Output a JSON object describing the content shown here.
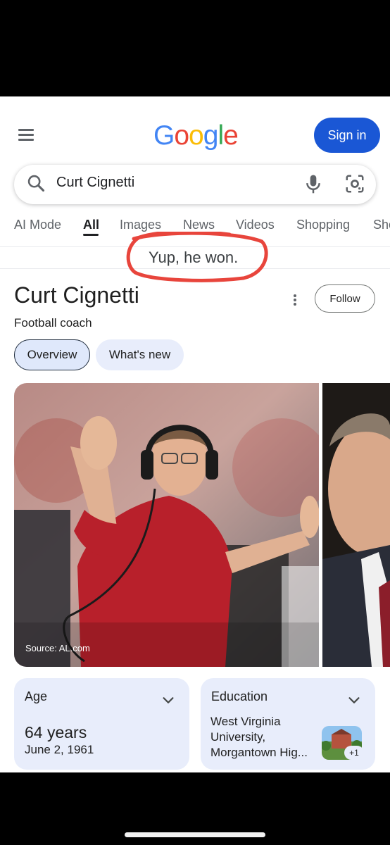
{
  "header": {
    "logo_letters": [
      {
        "ch": "G",
        "color": "#4285F4"
      },
      {
        "ch": "o",
        "color": "#EA4335"
      },
      {
        "ch": "o",
        "color": "#FBBC05"
      },
      {
        "ch": "g",
        "color": "#4285F4"
      },
      {
        "ch": "l",
        "color": "#34A853"
      },
      {
        "ch": "e",
        "color": "#EA4335"
      }
    ],
    "signin_label": "Sign in",
    "signin_color": "#1A57D5"
  },
  "search": {
    "query": "Curt Cignetti"
  },
  "tabs": [
    {
      "label": "AI Mode"
    },
    {
      "label": "All",
      "active": true
    },
    {
      "label": "Images"
    },
    {
      "label": "News"
    },
    {
      "label": "Videos"
    },
    {
      "label": "Shopping"
    },
    {
      "label": "Sho"
    }
  ],
  "annotation": {
    "text": "Yup, he won.",
    "circle_color": "#E8453C"
  },
  "knowledge_panel": {
    "title": "Curt Cignetti",
    "subtitle": "Football coach",
    "follow_label": "Follow",
    "chips": [
      "Overview",
      "What's new"
    ],
    "photo_source": "Source: AL.com",
    "age": {
      "label": "Age",
      "value": "64 years",
      "date": "June 2, 1961"
    },
    "education": {
      "label": "Education",
      "lines": [
        "West Virginia",
        "University,",
        "Morgantown Hig..."
      ],
      "more_count": "+1"
    }
  }
}
